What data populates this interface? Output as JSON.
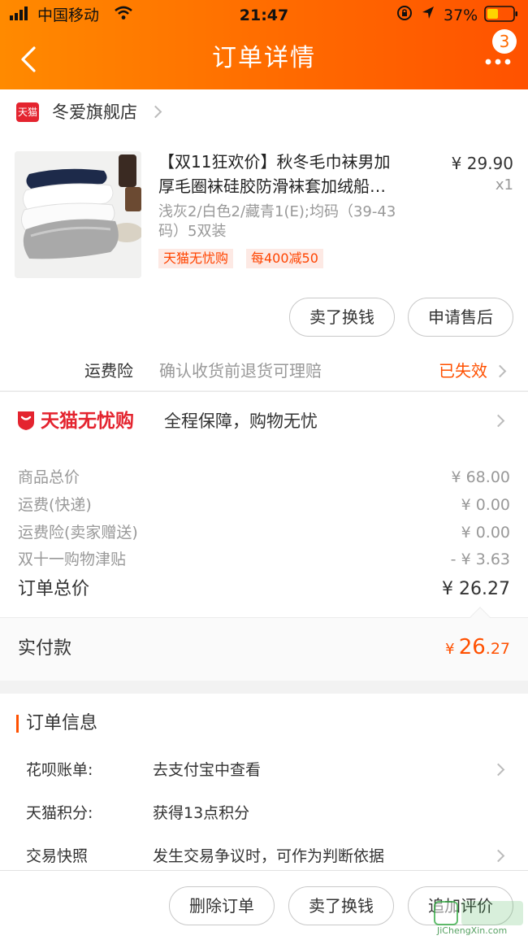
{
  "status_bar": {
    "carrier": "中国移动",
    "time": "21:47",
    "battery": "37%"
  },
  "header": {
    "title": "订单详情",
    "badge_count": "3"
  },
  "shop": {
    "logo_text": "天猫",
    "name": "冬爱旗舰店"
  },
  "product": {
    "title_line1": "【双11狂欢价】秋冬毛巾袜男加",
    "title_line2": "厚毛圈袜硅胶防滑袜套加绒船…",
    "sku_line1": "浅灰2/白色2/藏青1(E);均码（39-43",
    "sku_line2": "码）5双装",
    "price": "¥ 29.90",
    "quantity": "x1",
    "tags": [
      "天猫无忧购",
      "每400减50"
    ]
  },
  "item_actions": {
    "sell": "卖了换钱",
    "after_sale": "申请售后"
  },
  "freight_insurance": {
    "label": "运费险",
    "desc": "确认收货前退货可理赔",
    "status": "已失效"
  },
  "guarantee": {
    "brand": "天猫无忧购",
    "desc": "全程保障，购物无忧"
  },
  "price_summary": [
    {
      "label": "商品总价",
      "value": "¥ 68.00"
    },
    {
      "label": "运费(快递)",
      "value": "¥ 0.00"
    },
    {
      "label": "运费险(卖家赠送)",
      "value": "¥ 0.00"
    },
    {
      "label": "双十一购物津贴",
      "value": "- ¥ 3.63"
    }
  ],
  "order_total": {
    "label": "订单总价",
    "value": "¥ 26.27"
  },
  "paid": {
    "label": "实付款",
    "currency": "¥",
    "integer": "26",
    "decimal": ".27"
  },
  "order_info": {
    "title": "订单信息",
    "rows": [
      {
        "label": "花呗账单:",
        "value": "去支付宝中查看"
      },
      {
        "label": "天猫积分:",
        "value": "获得13点积分"
      },
      {
        "label": "交易快照",
        "value": "发生交易争议时，可作为判断依据"
      }
    ]
  },
  "bottom_bar": {
    "delete": "删除订单",
    "sell": "卖了换钱",
    "review": "追加评价"
  },
  "watermark": {
    "text": "JiChengXin.com"
  },
  "colors": {
    "accent": "#ff5000",
    "header_start": "#ff8a00",
    "header_end": "#ff5200",
    "tmall_red": "#e4242f"
  }
}
